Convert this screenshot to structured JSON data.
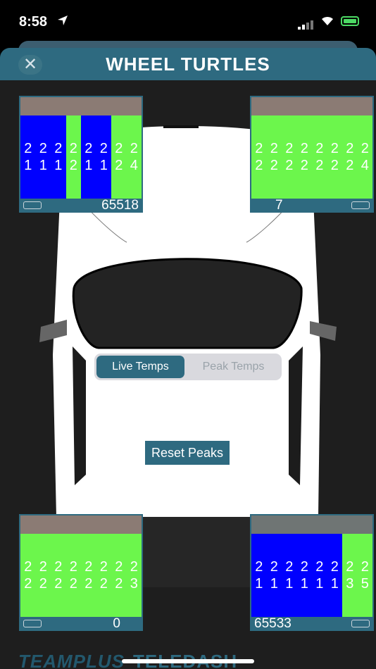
{
  "status": {
    "time": "8:58"
  },
  "header": {
    "title": "WHEEL TURTLES",
    "close_glyph": "✕"
  },
  "colors": {
    "accent": "#2e6a80",
    "hot": "#0000ff",
    "ok": "#6cf64c",
    "header_brown": "#8b7b74",
    "header_grey": "#6f7574"
  },
  "tyres": {
    "front_left": {
      "header_color": "#8b7b74",
      "columns": [
        {
          "top": "2",
          "bottom": "1",
          "color": "#0000ff"
        },
        {
          "top": "2",
          "bottom": "1",
          "color": "#0000ff"
        },
        {
          "top": "2",
          "bottom": "1",
          "color": "#0000ff"
        },
        {
          "top": "2",
          "bottom": "2",
          "color": "#6cf64c"
        },
        {
          "top": "2",
          "bottom": "1",
          "color": "#0000ff"
        },
        {
          "top": "2",
          "bottom": "1",
          "color": "#0000ff"
        },
        {
          "top": "2",
          "bottom": "2",
          "color": "#6cf64c"
        },
        {
          "top": "2",
          "bottom": "4",
          "color": "#6cf64c"
        }
      ],
      "count": "65518"
    },
    "front_right": {
      "header_color": "#8b7b74",
      "columns": [
        {
          "top": "2",
          "bottom": "2",
          "color": "#6cf64c"
        },
        {
          "top": "2",
          "bottom": "2",
          "color": "#6cf64c"
        },
        {
          "top": "2",
          "bottom": "2",
          "color": "#6cf64c"
        },
        {
          "top": "2",
          "bottom": "2",
          "color": "#6cf64c"
        },
        {
          "top": "2",
          "bottom": "2",
          "color": "#6cf64c"
        },
        {
          "top": "2",
          "bottom": "2",
          "color": "#6cf64c"
        },
        {
          "top": "2",
          "bottom": "2",
          "color": "#6cf64c"
        },
        {
          "top": "2",
          "bottom": "4",
          "color": "#6cf64c"
        }
      ],
      "count": "7"
    },
    "rear_left": {
      "header_color": "#8b7b74",
      "columns": [
        {
          "top": "2",
          "bottom": "2",
          "color": "#6cf64c"
        },
        {
          "top": "2",
          "bottom": "2",
          "color": "#6cf64c"
        },
        {
          "top": "2",
          "bottom": "2",
          "color": "#6cf64c"
        },
        {
          "top": "2",
          "bottom": "2",
          "color": "#6cf64c"
        },
        {
          "top": "2",
          "bottom": "2",
          "color": "#6cf64c"
        },
        {
          "top": "2",
          "bottom": "2",
          "color": "#6cf64c"
        },
        {
          "top": "2",
          "bottom": "2",
          "color": "#6cf64c"
        },
        {
          "top": "2",
          "bottom": "3",
          "color": "#6cf64c"
        }
      ],
      "count": "0"
    },
    "rear_right": {
      "header_color": "#6f7574",
      "columns": [
        {
          "top": "2",
          "bottom": "1",
          "color": "#0000ff"
        },
        {
          "top": "2",
          "bottom": "1",
          "color": "#0000ff"
        },
        {
          "top": "2",
          "bottom": "1",
          "color": "#0000ff"
        },
        {
          "top": "2",
          "bottom": "1",
          "color": "#0000ff"
        },
        {
          "top": "2",
          "bottom": "1",
          "color": "#0000ff"
        },
        {
          "top": "2",
          "bottom": "1",
          "color": "#0000ff"
        },
        {
          "top": "2",
          "bottom": "3",
          "color": "#6cf64c"
        },
        {
          "top": "2",
          "bottom": "5",
          "color": "#6cf64c"
        }
      ],
      "count": "65533"
    }
  },
  "segmented": {
    "live_label": "Live Temps",
    "peak_label": "Peak Temps",
    "selected": "Live Temps"
  },
  "reset_label": "Reset Peaks",
  "logo": {
    "team": "TEAMPLUS",
    "product": "TELEDASH"
  }
}
